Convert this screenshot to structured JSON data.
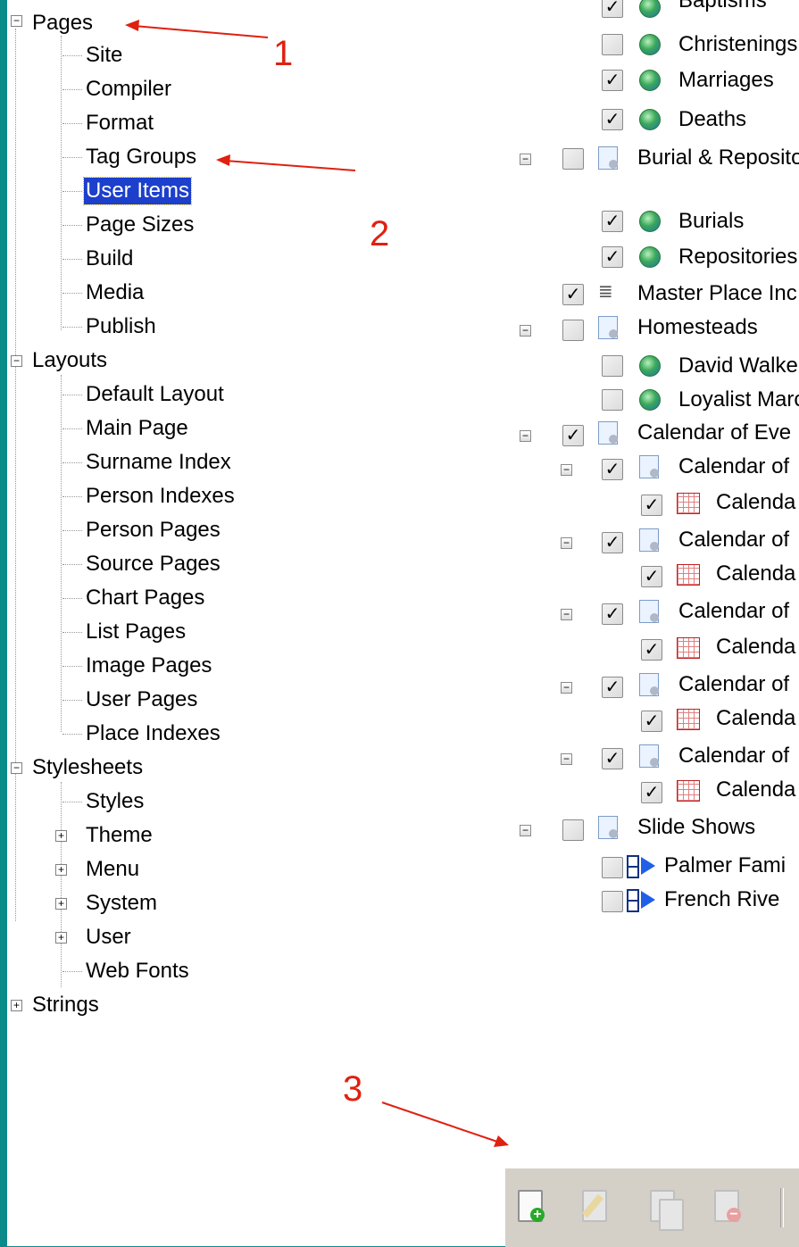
{
  "left_tree": {
    "pages": {
      "label": "Pages",
      "items": [
        "Site",
        "Compiler",
        "Format",
        "Tag Groups",
        "User Items",
        "Page Sizes",
        "Build",
        "Media",
        "Publish"
      ]
    },
    "layouts": {
      "label": "Layouts",
      "items": [
        "Default Layout",
        "Main Page",
        "Surname Index",
        "Person Indexes",
        "Person Pages",
        "Source Pages",
        "Chart Pages",
        "List Pages",
        "Image Pages",
        "User Pages",
        "Place Indexes"
      ]
    },
    "stylesheets": {
      "label": "Stylesheets",
      "items": [
        "Styles",
        "Theme",
        "Menu",
        "System",
        "User",
        "Web Fonts"
      ]
    },
    "strings": {
      "label": "Strings"
    }
  },
  "right_tree": {
    "baptisms": "Baptisms",
    "christenings": "Christenings",
    "marriages": "Marriages",
    "deaths": "Deaths",
    "burial_repos": "Burial & Reposito",
    "burials": "Burials",
    "repositories": "Repositories",
    "master_place": "Master Place Inc",
    "homesteads": "Homesteads",
    "david_walker": "David Walke",
    "loyalist": "Loyalist Marc",
    "calendar_events": "Calendar of Eve",
    "calendar_of": "Calendar of",
    "calenda": "Calenda",
    "slide_shows": "Slide Shows",
    "palmer": "Palmer Fami",
    "french_river": "French Rive"
  },
  "annotations": [
    "1",
    "2",
    "3"
  ],
  "colors": {
    "selection": "#1c3fcc",
    "annotation": "#e02010",
    "frame": "#0b8a8a"
  }
}
